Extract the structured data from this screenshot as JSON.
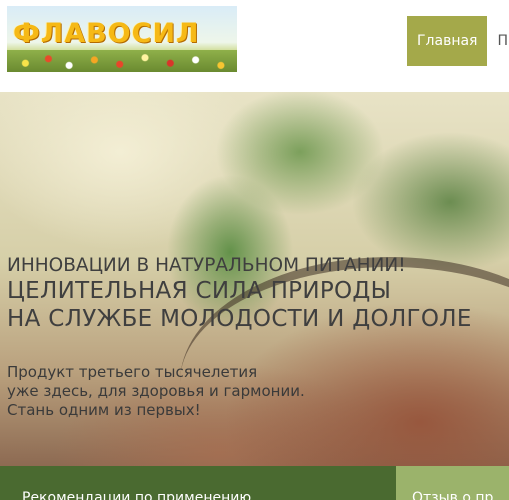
{
  "header": {
    "logo_text": "ФЛАВОСИЛ",
    "nav": [
      {
        "label": "Главная",
        "active": true
      },
      {
        "label": "Пр"
      }
    ]
  },
  "hero": {
    "line1": "ИННОВАЦИИ В НАТУРАЛЬНОМ ПИТАНИИ!",
    "line2": "ЦЕЛИТЕЛЬНАЯ СИЛА ПРИРОДЫ",
    "line3": "НА СЛУЖБЕ МОЛОДОСТИ И ДОЛГОЛЕ",
    "paragraph": [
      "Продукт третьего тысячелетия",
      "уже здесь, для здоровья и гармонии.",
      "Стань одним из первых!"
    ]
  },
  "bottom_bar": {
    "primary_label": "Рекомендации по применению",
    "secondary_label": "Отзыв о пр"
  },
  "colors": {
    "nav_active": "#a4a94a",
    "bottom_primary": "#4a6a30",
    "bottom_secondary": "#9bb36b",
    "logo_text": "#f6b916"
  }
}
